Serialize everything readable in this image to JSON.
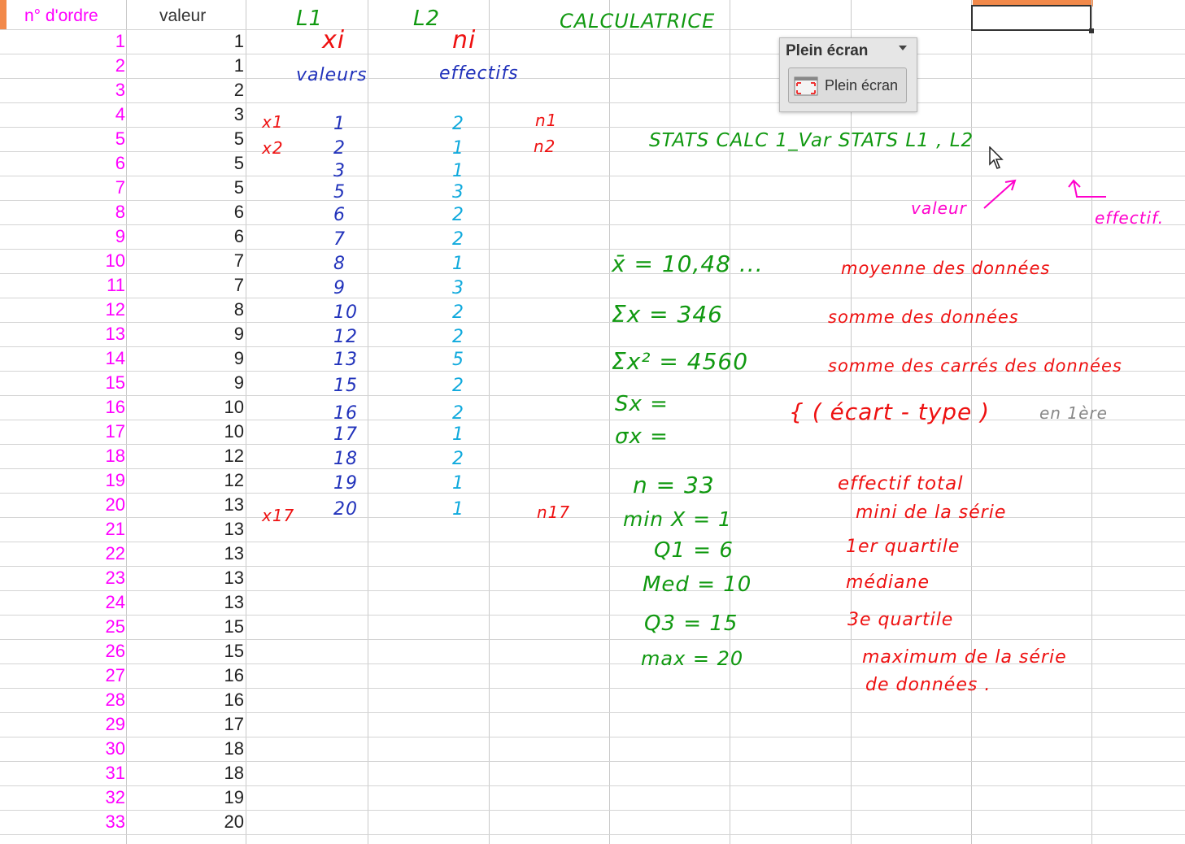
{
  "columns": {
    "order_header": "n° d'ordre",
    "value_header": "valeur"
  },
  "rows": {
    "order": [
      "1",
      "2",
      "3",
      "4",
      "5",
      "6",
      "7",
      "8",
      "9",
      "10",
      "11",
      "12",
      "13",
      "14",
      "15",
      "16",
      "17",
      "18",
      "19",
      "20",
      "21",
      "22",
      "23",
      "24",
      "25",
      "26",
      "27",
      "28",
      "29",
      "30",
      "31",
      "32",
      "33"
    ],
    "values": [
      "1",
      "1",
      "2",
      "3",
      "5",
      "5",
      "5",
      "6",
      "6",
      "7",
      "7",
      "8",
      "9",
      "9",
      "9",
      "10",
      "10",
      "12",
      "12",
      "13",
      "13",
      "13",
      "13",
      "13",
      "15",
      "15",
      "16",
      "16",
      "17",
      "18",
      "18",
      "19",
      "20"
    ]
  },
  "notes": {
    "L1": "L1",
    "L2": "L2",
    "calculatrice": "CALCULATRICE",
    "xi": "xi",
    "ni": "ni",
    "valeurs": "valeurs",
    "effectifs": "effectifs",
    "x1": "x1",
    "x2": "x2",
    "x17": "x17",
    "n1": "n1",
    "n2": "n2",
    "n17": "n17",
    "xi_list": [
      "1",
      "2",
      "3",
      "5",
      "6",
      "7",
      "8",
      "9",
      "10",
      "12",
      "13",
      "15",
      "16",
      "17",
      "18",
      "19",
      "20"
    ],
    "ni_list": [
      "2",
      "1",
      "1",
      "3",
      "2",
      "2",
      "1",
      "3",
      "2",
      "2",
      "5",
      "2",
      "2",
      "1",
      "2",
      "1",
      "1"
    ],
    "stats_line": "STATS CALC 1_Var STATS L1 , L2",
    "valeur_arrow": "valeur",
    "effectif_arrow": "effectif.",
    "mean": "x̄ = 10,48 ...",
    "mean_label": "moyenne des données",
    "sum": "Σx = 346",
    "sum_label": "somme des données",
    "sumsq": "Σx² = 4560",
    "sumsq_label": "somme des carrés des données",
    "sx": "Sx =",
    "sigma": "σx =",
    "ecart_type": "{ ( écart - type )",
    "en_1ere": "en 1ère",
    "n_total": "n = 33",
    "n_total_label": "effectif total",
    "minx": "min X = 1",
    "minx_label": "mini de la série",
    "q1": "Q1 = 6",
    "q1_label": "1er quartile",
    "med": "Med = 10",
    "med_label": "médiane",
    "q3": "Q3 = 15",
    "q3_label": "3e quartile",
    "max": "max = 20",
    "max_label_1": "maximum de la série",
    "max_label_2": "de données ."
  },
  "fullscreen": {
    "title": "Plein écran",
    "button_label": "Plein écran"
  }
}
